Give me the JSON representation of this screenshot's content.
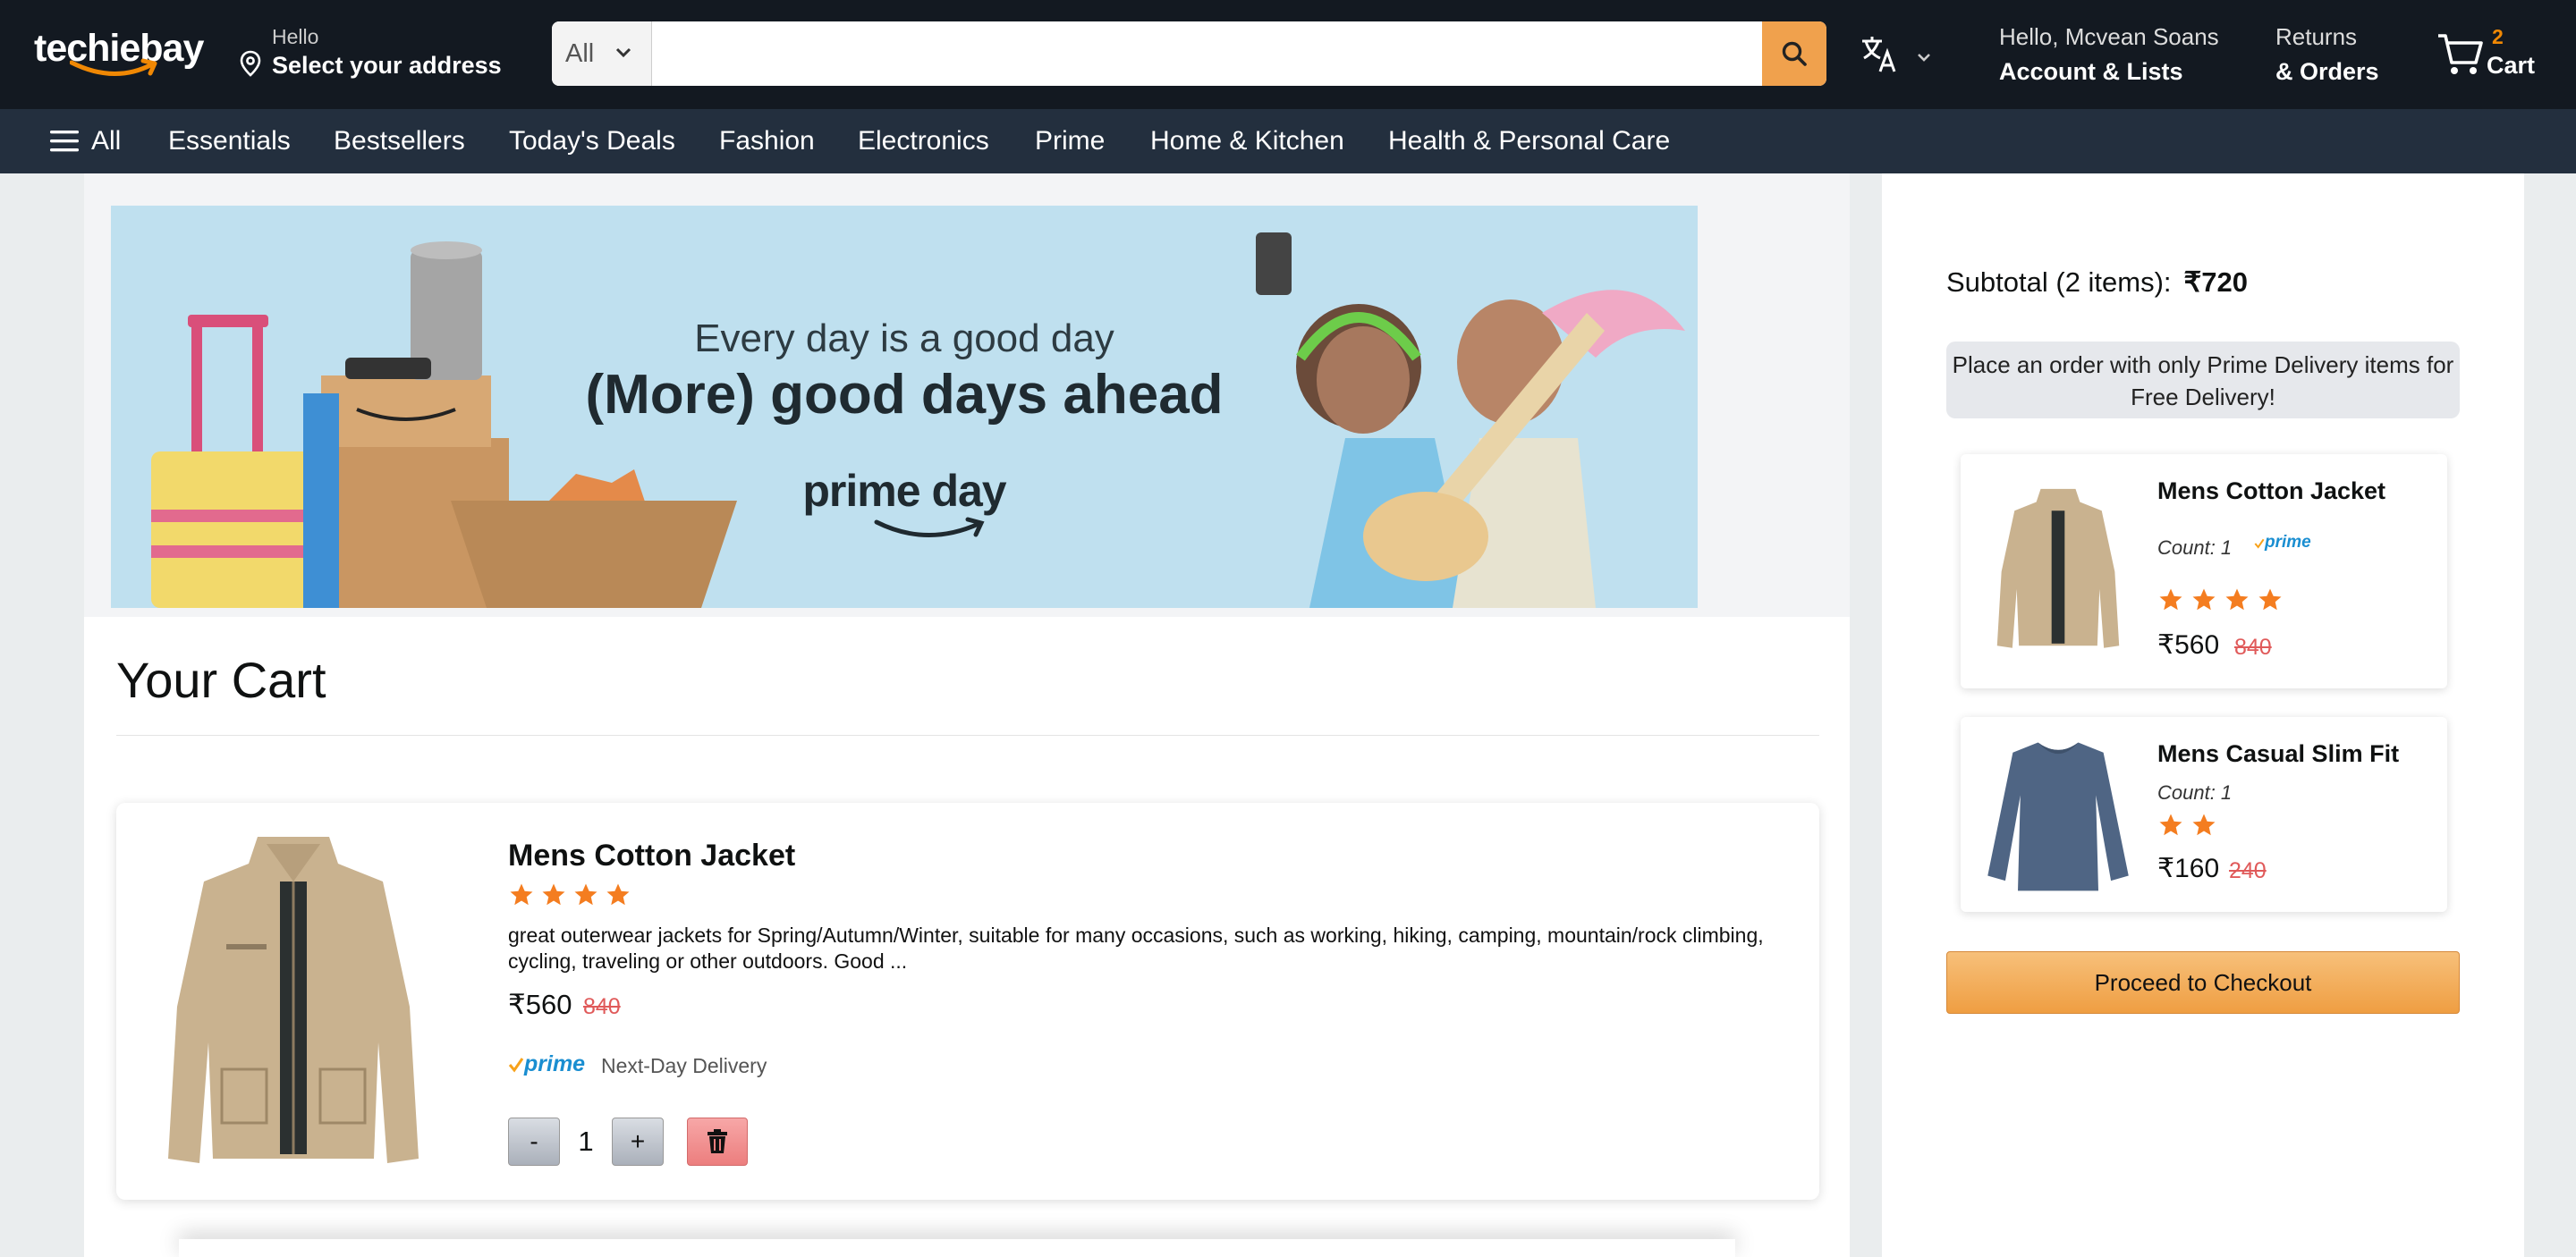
{
  "header": {
    "logo_text": "techiebay",
    "address_hello": "Hello",
    "address_select": "Select your address",
    "search": {
      "category": "All",
      "placeholder": ""
    },
    "account_greeting": "Hello, Mcvean Soans",
    "account_label": "Account & Lists",
    "returns_label": "Returns",
    "orders_label": "& Orders",
    "cart_count": "2",
    "cart_label": "Cart",
    "accent_color": "#f0a14d"
  },
  "nav": {
    "all_label": "All",
    "items": [
      "Essentials",
      "Bestsellers",
      "Today's Deals",
      "Fashion",
      "Electronics",
      "Prime",
      "Home & Kitchen",
      "Health & Personal Care"
    ]
  },
  "banner": {
    "line1": "Every day is a good day",
    "line2": "(More) good days ahead",
    "line3": "prime day"
  },
  "cart_page": {
    "title": "Your Cart",
    "item": {
      "name": "Mens Cotton Jacket",
      "rating_stars": 4,
      "description": "great outerwear jackets for Spring/Autumn/Winter, suitable for many occasions, such as working, hiking, camping, mountain/rock climbing, cycling, traveling or other outdoors. Good ...",
      "price": "₹560",
      "mrp": "840",
      "prime_label": "prime",
      "delivery": "Next-Day Delivery",
      "qty_minus": "-",
      "qty_value": "1",
      "qty_plus": "+"
    }
  },
  "summary": {
    "subtotal_label": "Subtotal (2 items):",
    "subtotal_value": "₹720",
    "notice": "Place an order with only Prime Delivery items for Free Delivery!",
    "items": [
      {
        "name": "Mens Cotton Jacket",
        "count": "Count: 1",
        "prime_label": "prime",
        "rating_stars": 4,
        "price": "₹560",
        "mrp": "840"
      },
      {
        "name": "Mens Casual Slim Fit",
        "count": "Count: 1",
        "rating_stars": 2,
        "price": "₹160",
        "mrp": "240"
      }
    ],
    "checkout_label": "Proceed to Checkout"
  }
}
